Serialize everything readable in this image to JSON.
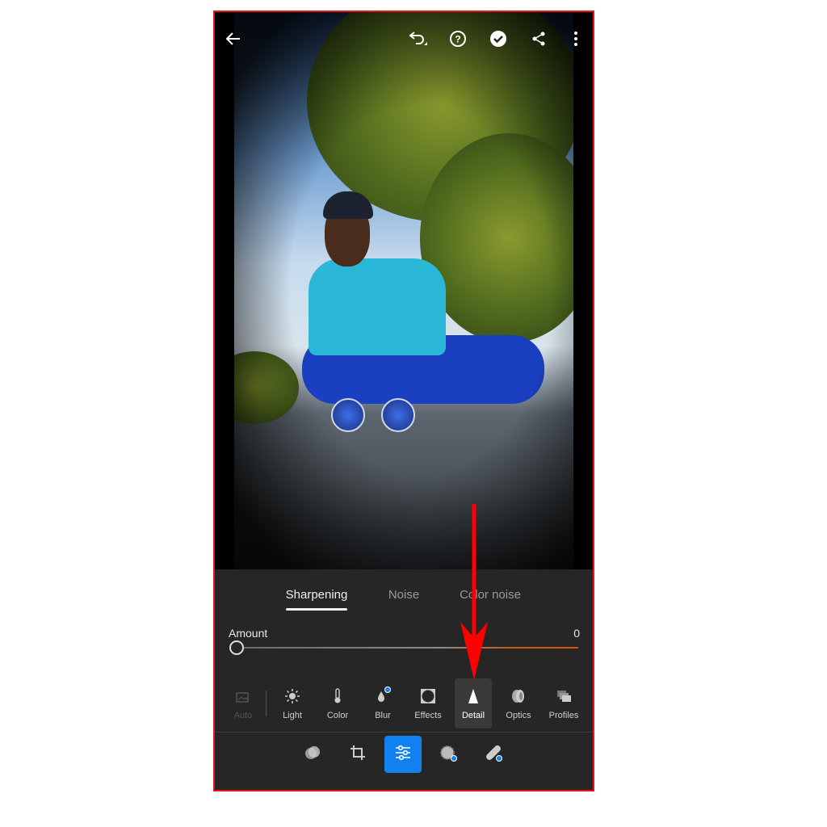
{
  "top_bar": {
    "icons": [
      "back-arrow-icon",
      "undo-icon",
      "help-icon",
      "checkmark-icon",
      "share-icon",
      "more-icon"
    ]
  },
  "detail_panel": {
    "tabs": [
      {
        "label": "Sharpening",
        "active": true
      },
      {
        "label": "Noise",
        "active": false
      },
      {
        "label": "Color noise",
        "active": false
      }
    ],
    "slider": {
      "label": "Amount",
      "value": "0",
      "fraction": 0
    }
  },
  "tools": [
    {
      "label": "Auto",
      "icon": "auto-icon",
      "disabled": true
    },
    {
      "label": "Light",
      "icon": "sun-icon"
    },
    {
      "label": "Color",
      "icon": "thermometer-icon"
    },
    {
      "label": "Blur",
      "icon": "blur-drop-icon",
      "badge": true
    },
    {
      "label": "Effects",
      "icon": "effects-vignette-icon"
    },
    {
      "label": "Detail",
      "icon": "detail-triangle-icon",
      "selected": true
    },
    {
      "label": "Optics",
      "icon": "lens-icon"
    },
    {
      "label": "Profiles",
      "icon": "profiles-stack-icon"
    }
  ],
  "bottom_toolbar": {
    "icons": [
      "presets-icon",
      "crop-icon",
      "edit-sliders-icon",
      "masking-icon",
      "healing-icon"
    ],
    "selected": "edit-sliders-icon"
  },
  "colors": {
    "accent": "#1181f0",
    "annotation": "#e8141b",
    "panel": "#262626"
  }
}
